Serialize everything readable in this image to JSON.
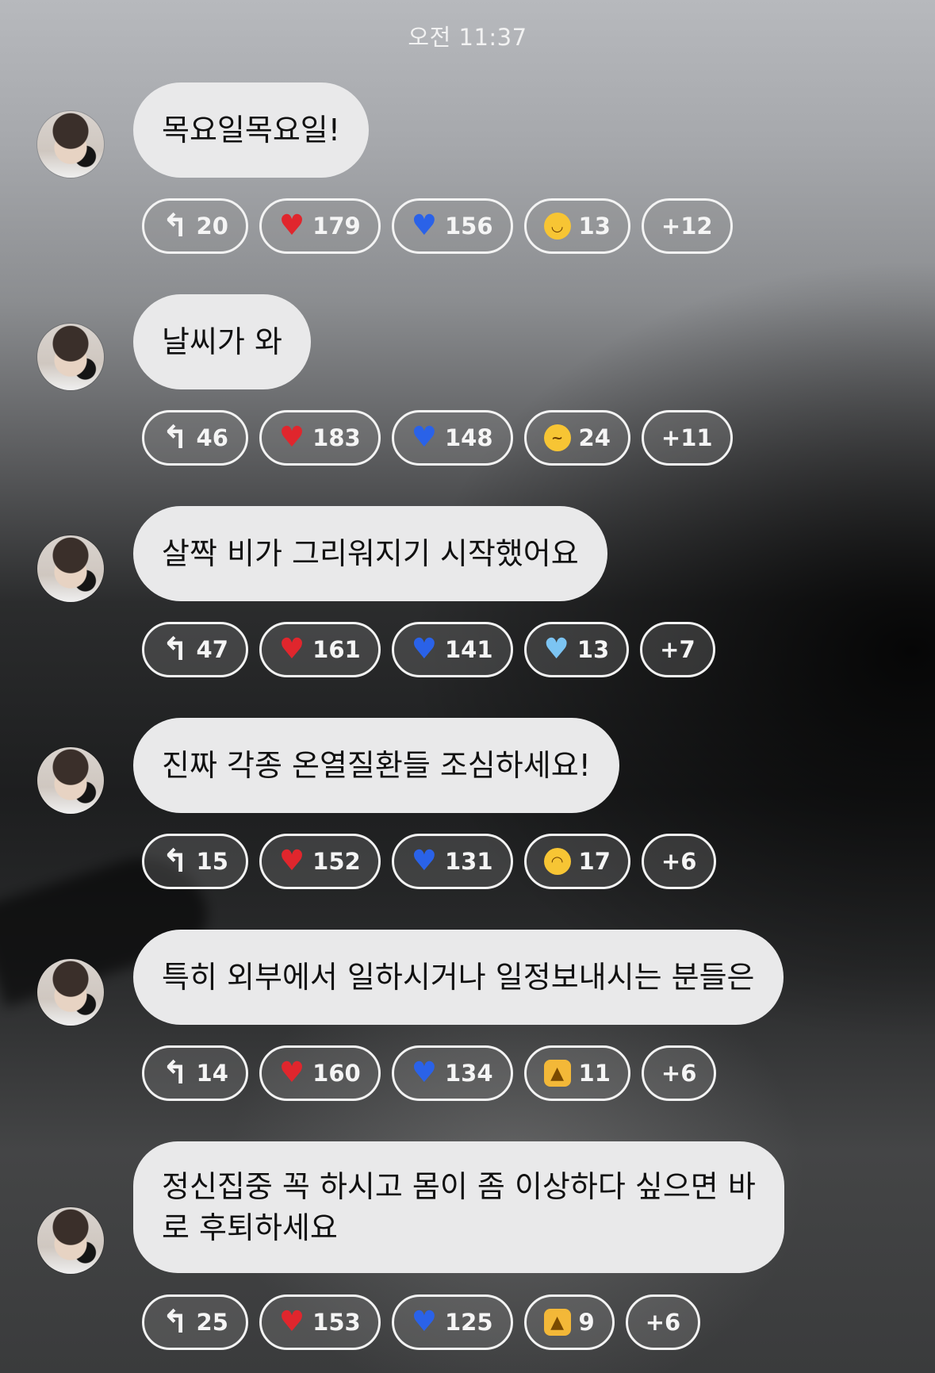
{
  "timestamp": "오전 11:37",
  "messages": [
    {
      "text": "목요일목요일!",
      "reactions": {
        "reply": "20",
        "red_heart": "179",
        "blue_heart": "156",
        "third_icon": "laughing-crying-face-icon",
        "third": "13",
        "more": "+12"
      }
    },
    {
      "text": "날씨가 와",
      "reactions": {
        "reply": "46",
        "red_heart": "183",
        "blue_heart": "148",
        "third_icon": "melting-face-icon",
        "third": "24",
        "more": "+11"
      }
    },
    {
      "text": "살짝 비가 그리워지기 시작했어요",
      "reactions": {
        "reply": "47",
        "red_heart": "161",
        "blue_heart": "141",
        "third_icon": "light-blue-heart-icon",
        "third": "13",
        "more": "+7"
      }
    },
    {
      "text": "진짜 각종 온열질환들 조심하세요!",
      "reactions": {
        "reply": "15",
        "red_heart": "152",
        "blue_heart": "131",
        "third_icon": "crying-face-icon",
        "third": "17",
        "more": "+6"
      }
    },
    {
      "text": "특히 외부에서 일하시거나 일정보내시는 분들은",
      "reactions": {
        "reply": "14",
        "red_heart": "160",
        "blue_heart": "134",
        "third_icon": "thumbs-up-icon",
        "third": "11",
        "more": "+6"
      }
    },
    {
      "text": "정신집중 꼭 하시고 몸이 좀 이상하다 싶으면 바\n로 후퇴하세요",
      "reactions": {
        "reply": "25",
        "red_heart": "153",
        "blue_heart": "125",
        "third_icon": "thumbs-up-icon",
        "third": "9",
        "more": "+6"
      }
    }
  ],
  "colors": {
    "bubble": "#e9e9ea",
    "red_heart": "#e0262d",
    "blue_heart": "#2a62e8",
    "light_blue_heart": "#7cc4f2",
    "pill_border": "#f3f3f3"
  }
}
